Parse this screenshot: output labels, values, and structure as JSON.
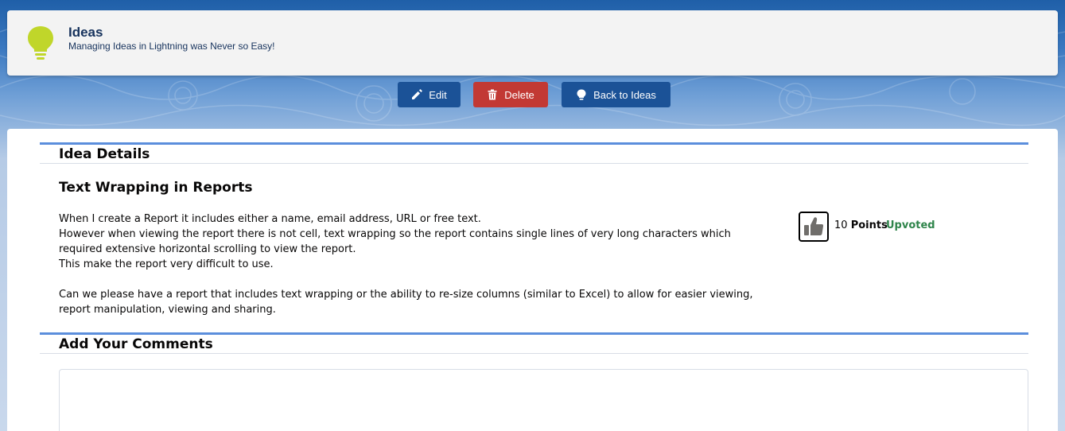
{
  "header": {
    "title": "Ideas",
    "subtitle": "Managing Ideas in Lightning was Never so Easy!",
    "icon": "lightbulb-icon",
    "icon_color": "#c0d62a"
  },
  "toolbar": {
    "edit_label": "Edit",
    "delete_label": "Delete",
    "back_label": "Back to Ideas",
    "primary_color": "#1b5297",
    "danger_color": "#c23934"
  },
  "details": {
    "section_title": "Idea Details",
    "idea_title": "Text Wrapping in Reports",
    "body": [
      "When I create a Report it includes either a name, email address, URL or free text.",
      "However when viewing the report there is not cell, text wrapping so the report contains single lines of very long characters which required extensive horizontal scrolling to view the report.",
      "This make the report very difficult to use.",
      "",
      "Can we please have a report that includes text wrapping or the ability to re-size columns (similar to Excel) to allow for easier viewing, report manipulation, viewing and sharing."
    ],
    "points_value": "10",
    "points_label": "Points",
    "vote_status": "Upvoted",
    "vote_status_color": "#2e844a",
    "vote_icon": "thumbs-up-icon"
  },
  "comments": {
    "section_title": "Add Your Comments"
  },
  "accent_color": "#5b8edc"
}
